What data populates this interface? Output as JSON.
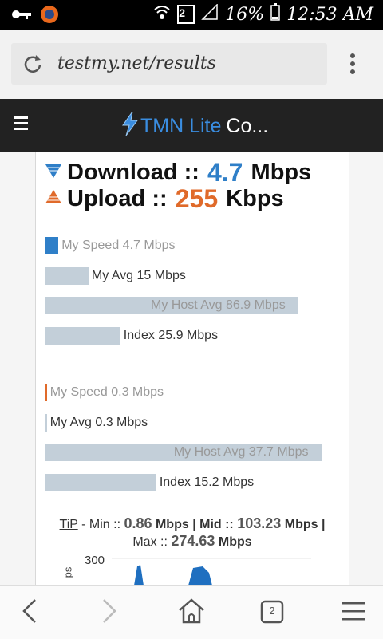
{
  "status_bar": {
    "sim": "2",
    "battery": "16%",
    "time": "12:53 AM"
  },
  "browser": {
    "url": "testmy.net/results",
    "tab_count": "2"
  },
  "site": {
    "brand_tmn": "TMN Lite",
    "brand_rest": "Co..."
  },
  "results": {
    "download_label": "Download ::",
    "download_value": "4.7",
    "download_unit": "Mbps",
    "upload_label": "Upload ::",
    "upload_value": "255",
    "upload_unit": "Kbps"
  },
  "download_bars": [
    {
      "label": "My Speed 4.7 Mbps",
      "value": 4.7
    },
    {
      "label": "My Avg 15 Mbps",
      "value": 15
    },
    {
      "label": "My Host Avg 86.9 Mbps",
      "value": 86.9
    },
    {
      "label": "Index 25.9 Mbps",
      "value": 25.9
    }
  ],
  "upload_bars": [
    {
      "label": "My Speed 0.3 Mbps",
      "value": 0.3
    },
    {
      "label": "My Avg 0.3 Mbps",
      "value": 0.3
    },
    {
      "label": "My Host Avg 37.7 Mbps",
      "value": 37.7
    },
    {
      "label": "Index 15.2 Mbps",
      "value": 15.2
    }
  ],
  "tip": {
    "link": "TiP",
    "min_label": "- Min ::",
    "min_value": "0.86",
    "mid_label": "Mbps | Mid ::",
    "mid_value": "103.23",
    "mid_unit": "Mbps |",
    "max_label": "Max ::",
    "max_value": "274.63",
    "max_unit": "Mbps"
  },
  "graph": {
    "y_tick": "300",
    "y_label_fragment": "ps"
  },
  "colors": {
    "download": "#2f7fc8",
    "upload": "#e06a2a",
    "bar": "#c3cfd9"
  }
}
